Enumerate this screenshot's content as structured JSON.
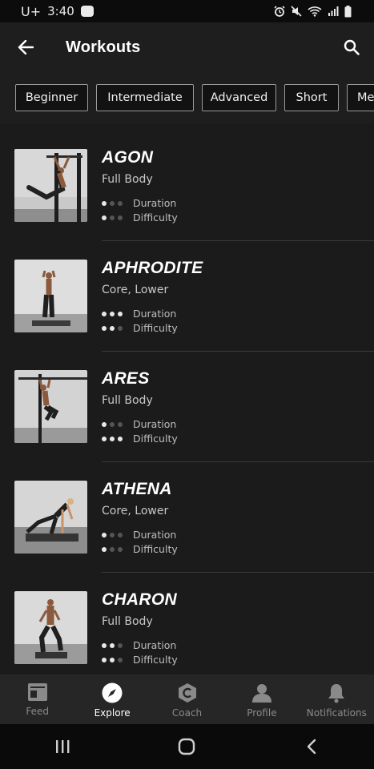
{
  "status_bar": {
    "carrier": "U+",
    "time": "3:40",
    "icons": [
      "alarm-icon",
      "mute-icon",
      "wifi-icon",
      "signal-icon",
      "battery-icon"
    ]
  },
  "app_bar": {
    "title": "Workouts",
    "back_icon": "arrow-left-icon",
    "search_icon": "search-icon"
  },
  "filters": [
    "Beginner",
    "Intermediate",
    "Advanced",
    "Short",
    "Me"
  ],
  "workouts": [
    {
      "name": "AGON",
      "focus": "Full Body",
      "duration_level": 1,
      "difficulty_level": 1,
      "duration_label": "Duration",
      "difficulty_label": "Difficulty"
    },
    {
      "name": "APHRODITE",
      "focus": "Core, Lower",
      "duration_level": 3,
      "difficulty_level": 2,
      "duration_label": "Duration",
      "difficulty_label": "Difficulty"
    },
    {
      "name": "ARES",
      "focus": "Full Body",
      "duration_level": 1,
      "difficulty_level": 3,
      "duration_label": "Duration",
      "difficulty_label": "Difficulty"
    },
    {
      "name": "ATHENA",
      "focus": "Core, Lower",
      "duration_level": 1,
      "difficulty_level": 1,
      "duration_label": "Duration",
      "difficulty_label": "Difficulty"
    },
    {
      "name": "CHARON",
      "focus": "Full Body",
      "duration_level": 2,
      "difficulty_level": 2,
      "duration_label": "Duration",
      "difficulty_label": "Difficulty"
    }
  ],
  "bottom_nav": [
    {
      "label": "Feed",
      "icon": "feed-icon",
      "active": false
    },
    {
      "label": "Explore",
      "icon": "compass-icon",
      "active": true
    },
    {
      "label": "Coach",
      "icon": "coach-icon",
      "active": false
    },
    {
      "label": "Profile",
      "icon": "profile-icon",
      "active": false
    },
    {
      "label": "Notifications",
      "icon": "bell-icon",
      "active": false
    }
  ],
  "colors": {
    "background": "#1b1b1b",
    "app_bar": "#1e1e1e",
    "active": "#ffffff",
    "inactive": "#8a8a8a"
  }
}
